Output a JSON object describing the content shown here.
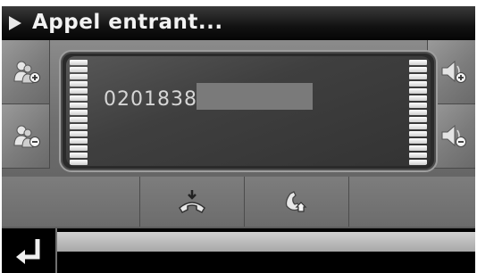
{
  "title": "Appel entrant...",
  "caller": {
    "number": "02018383"
  },
  "side_buttons": {
    "left_top": "add-contact-icon",
    "left_bottom": "remove-contact-icon",
    "right_top": "volume-up-icon",
    "right_bottom": "volume-down-icon"
  },
  "bottom_buttons": [
    "transfer-call-icon",
    "answer-call-icon"
  ],
  "colors": {
    "titlebar": "#121212",
    "panel": "#7a7a7a",
    "display": "#3a3a3a",
    "meter": "#ffffff"
  }
}
